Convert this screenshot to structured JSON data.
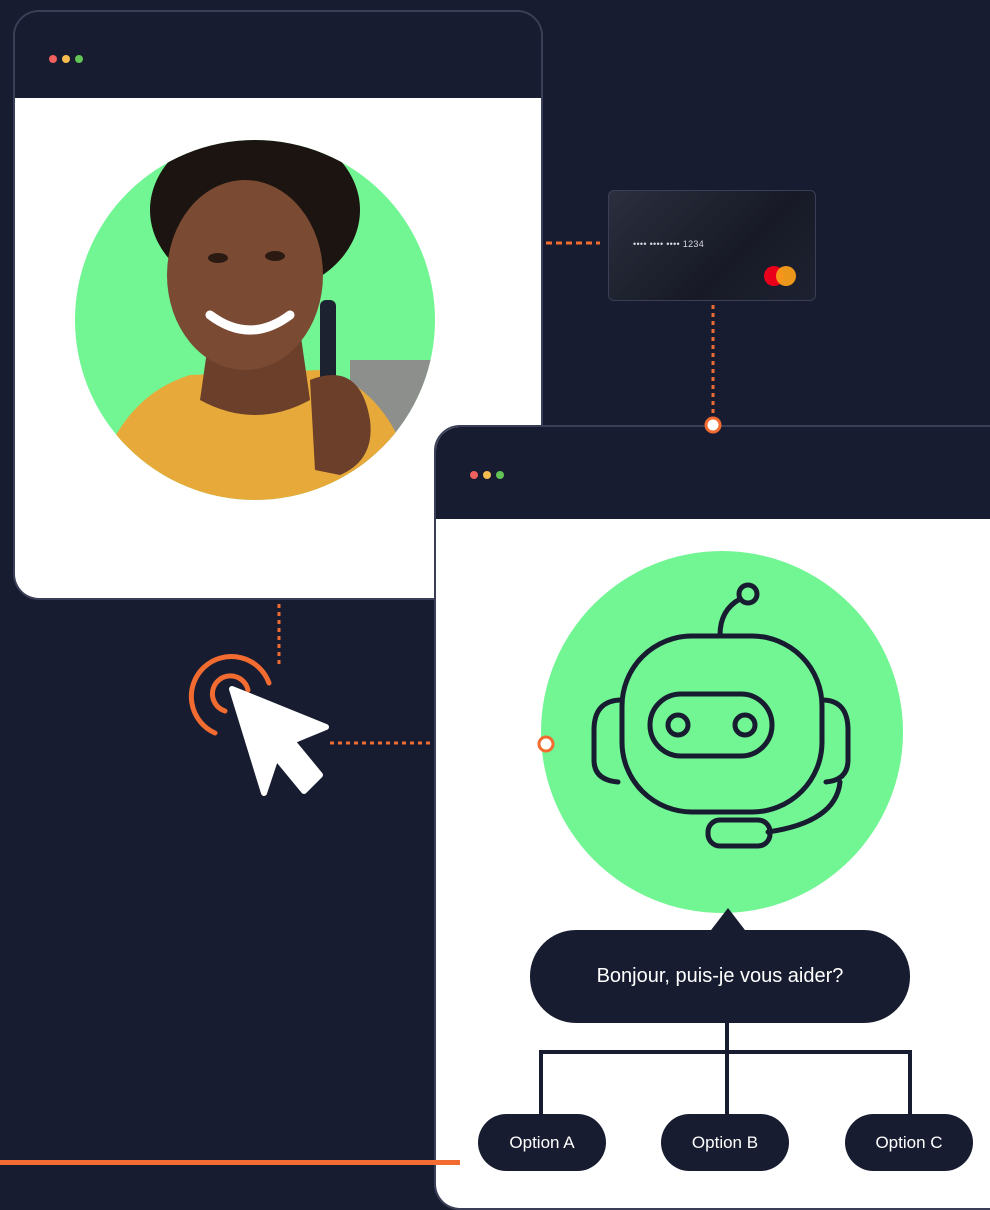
{
  "colors": {
    "background": "#181c30",
    "accent_orange": "#f26b30",
    "accent_green": "#72f593",
    "dot_red": "#f0605d",
    "dot_yellow": "#f5bd4f",
    "dot_green": "#61c454"
  },
  "card": {
    "number": "•••• •••• •••• 1234",
    "brand_icon": "mastercard-logo"
  },
  "chat": {
    "greeting": "Bonjour, puis-je vous aider?"
  },
  "options": [
    {
      "label": "Option A"
    },
    {
      "label": "Option B"
    },
    {
      "label": "Option C"
    }
  ],
  "icons": {
    "person": "woman-on-phone-photo",
    "bot": "robot-headset-icon",
    "cursor": "mouse-pointer-icon",
    "click": "click-ripple-icon"
  }
}
